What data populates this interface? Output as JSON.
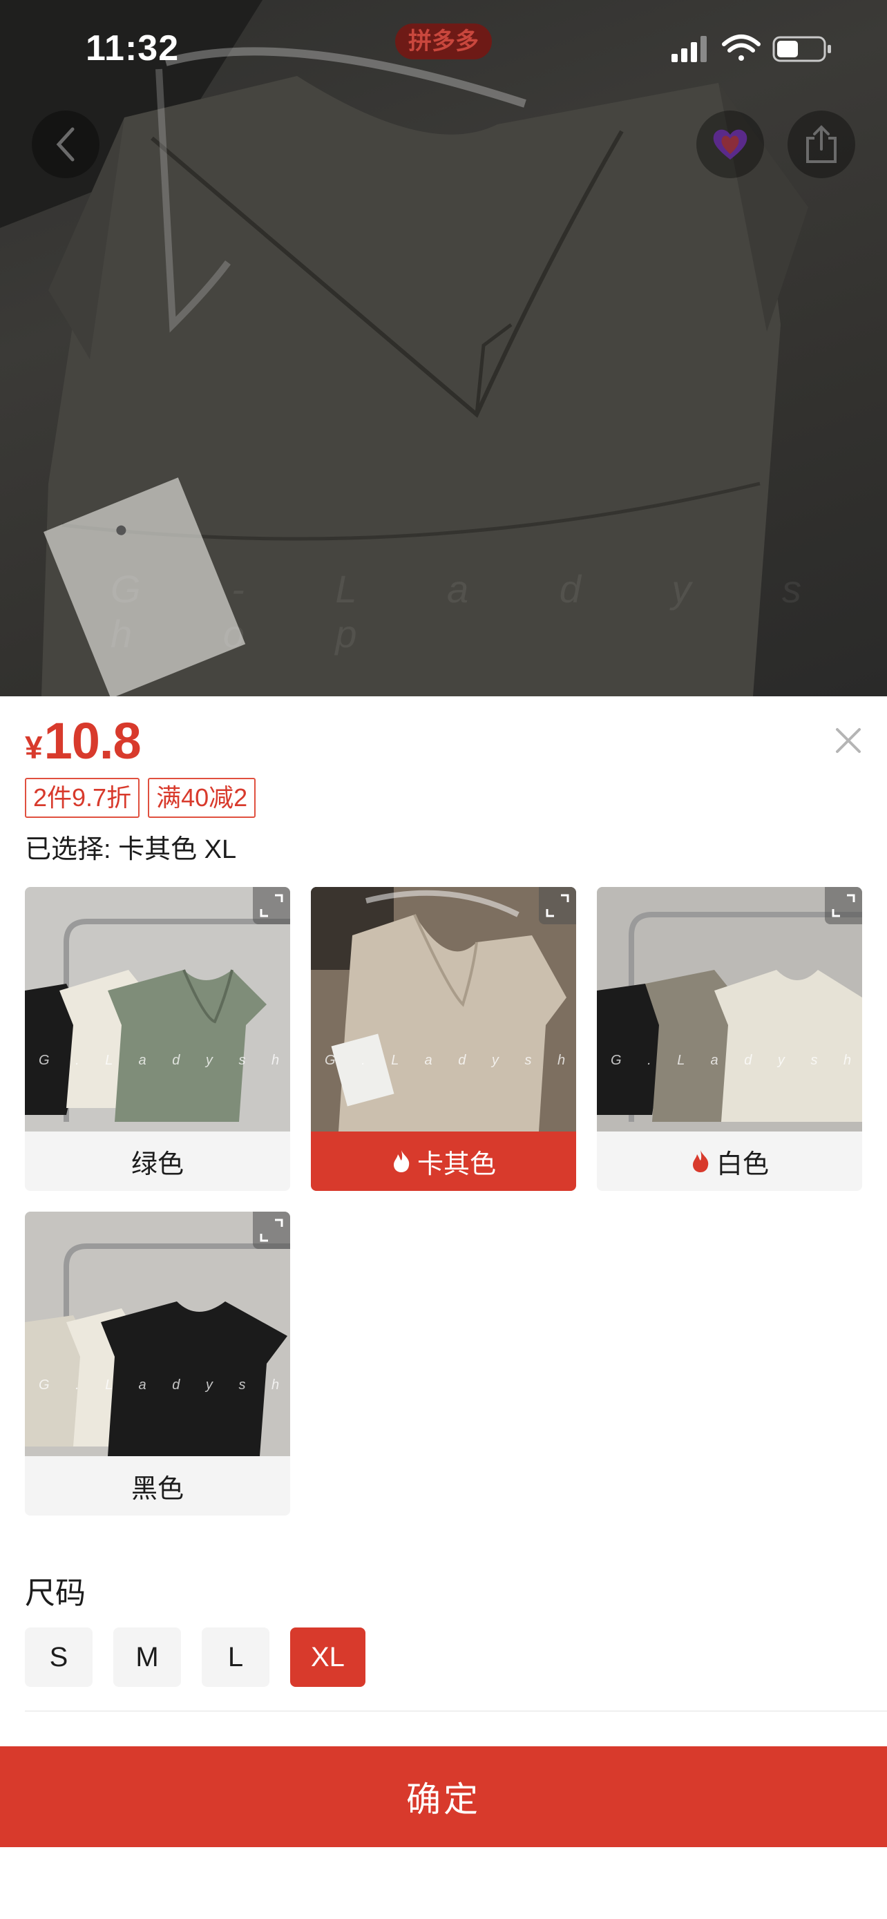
{
  "status_bar": {
    "time": "11:32",
    "app_logo_text": "拼多多",
    "icons": [
      "cellular-signal-icon",
      "wifi-icon",
      "battery-icon"
    ]
  },
  "hero": {
    "watermark": "G - L a d y s h o p",
    "buttons": [
      "back-icon",
      "favorite-icon",
      "share-icon"
    ]
  },
  "product": {
    "currency": "¥",
    "price": "10.8",
    "promos": [
      "2件9.7折",
      "满40减2"
    ],
    "selected_text": "已选择: 卡其色 XL"
  },
  "colors": [
    {
      "label": "绿色",
      "hot": false,
      "selected": false,
      "swatch": "#7f8d79"
    },
    {
      "label": "卡其色",
      "hot": true,
      "selected": true,
      "swatch": "#cbbfae"
    },
    {
      "label": "白色",
      "hot": true,
      "selected": false,
      "swatch": "#e6e2d6"
    },
    {
      "label": "黑色",
      "hot": false,
      "selected": false,
      "swatch": "#1b1b1b"
    }
  ],
  "thumb_watermark": "G . L a d y s h o p",
  "size_section": {
    "title": "尺码",
    "options": [
      "S",
      "M",
      "L",
      "XL"
    ],
    "selected": "XL"
  },
  "confirm_label": "确定",
  "theme": {
    "accent": "#d83a2c",
    "chip_bg": "#f4f4f4"
  }
}
